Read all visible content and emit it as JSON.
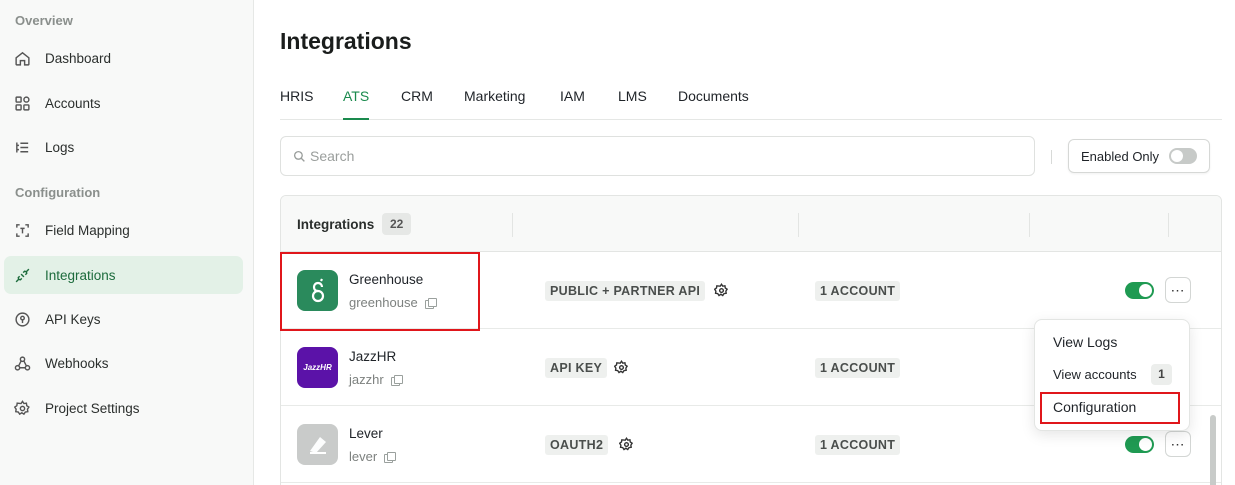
{
  "sidebar": {
    "sections": [
      {
        "label": "Overview"
      },
      {
        "label": "Configuration"
      }
    ],
    "items": [
      {
        "label": "Dashboard",
        "icon": "home-icon"
      },
      {
        "label": "Accounts",
        "icon": "grid-icon"
      },
      {
        "label": "Logs",
        "icon": "list-icon"
      },
      {
        "label": "Field Mapping",
        "icon": "text-frame-icon"
      },
      {
        "label": "Integrations",
        "icon": "plug-icon",
        "active": true
      },
      {
        "label": "API Keys",
        "icon": "key-icon"
      },
      {
        "label": "Webhooks",
        "icon": "webhook-icon"
      },
      {
        "label": "Project Settings",
        "icon": "gear-icon"
      }
    ]
  },
  "main": {
    "title": "Integrations",
    "tabs": [
      {
        "label": "HRIS"
      },
      {
        "label": "ATS",
        "active": true
      },
      {
        "label": "CRM"
      },
      {
        "label": "Marketing"
      },
      {
        "label": "IAM"
      },
      {
        "label": "LMS"
      },
      {
        "label": "Documents"
      }
    ],
    "search": {
      "placeholder": "Search"
    },
    "filter": {
      "label": "Enabled Only",
      "enabled": false
    },
    "table": {
      "header": {
        "label": "Integrations",
        "count": "22"
      },
      "rows": [
        {
          "name": "Greenhouse",
          "slug": "greenhouse",
          "auth": "PUBLIC + PARTNER API",
          "accounts": "1 ACCOUNT",
          "enabled": true,
          "logo_color": "#2a8a5c"
        },
        {
          "name": "JazzHR",
          "slug": "jazzhr",
          "auth": "API KEY",
          "accounts": "1 ACCOUNT",
          "enabled": true,
          "logo_color": "#5b12a8",
          "logo_text": "JazzHR"
        },
        {
          "name": "Lever",
          "slug": "lever",
          "auth": "OAUTH2",
          "accounts": "1 ACCOUNT",
          "enabled": true,
          "logo_color": "#c9cbca"
        }
      ]
    }
  },
  "menu": {
    "items": [
      {
        "label": "View Logs"
      },
      {
        "label": "View accounts",
        "badge": "1"
      },
      {
        "label": "Configuration"
      }
    ]
  },
  "colors": {
    "accent": "#1a8a4d",
    "active_bg": "#e3f1e7",
    "highlight": "#e0161b"
  }
}
